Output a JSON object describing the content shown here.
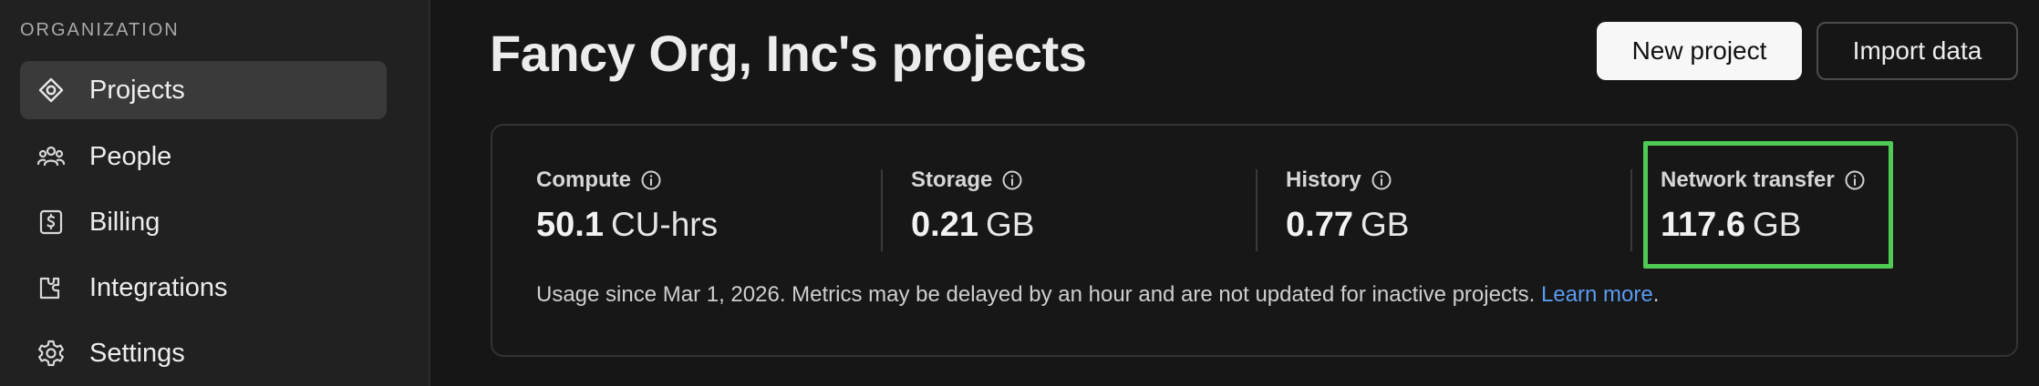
{
  "sidebar": {
    "section_title": "ORGANIZATION",
    "items": [
      {
        "label": "Projects",
        "icon": "projects-icon",
        "active": true
      },
      {
        "label": "People",
        "icon": "people-icon",
        "active": false
      },
      {
        "label": "Billing",
        "icon": "billing-icon",
        "active": false
      },
      {
        "label": "Integrations",
        "icon": "integrations-icon",
        "active": false
      },
      {
        "label": "Settings",
        "icon": "settings-icon",
        "active": false
      }
    ]
  },
  "header": {
    "title": "Fancy Org, Inc's projects",
    "new_project_label": "New project",
    "import_data_label": "Import data"
  },
  "usage": {
    "metrics": [
      {
        "label": "Compute",
        "value": "50.1",
        "unit": "CU-hrs"
      },
      {
        "label": "Storage",
        "value": "0.21",
        "unit": "GB"
      },
      {
        "label": "History",
        "value": "0.77",
        "unit": "GB"
      },
      {
        "label": "Network transfer",
        "value": "117.6",
        "unit": "GB",
        "highlighted": true
      }
    ],
    "note": "Usage since Mar 1, 2026. Metrics may be delayed by an hour and are not updated for inactive projects.",
    "learn_more": "Learn more",
    "note_suffix": "."
  },
  "colors": {
    "background": "#161616",
    "sidebar": "#212121",
    "active_item": "#3a3a3a",
    "link": "#5b9bf0",
    "highlight_border": "#4fcb55"
  }
}
